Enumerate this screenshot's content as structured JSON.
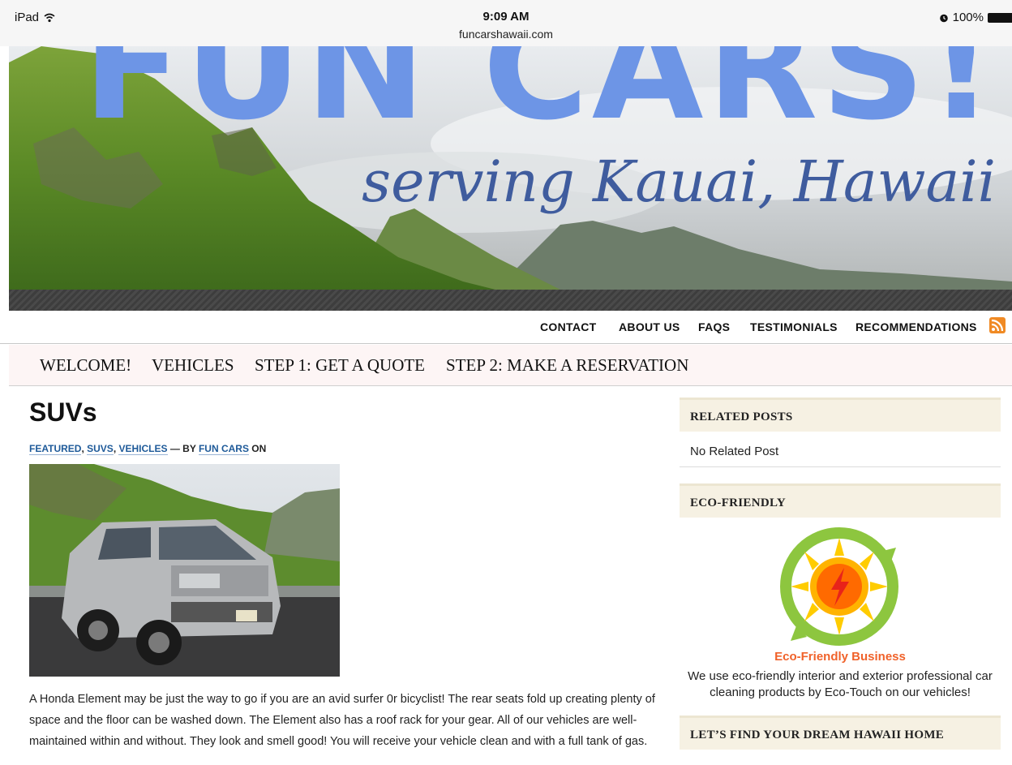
{
  "status": {
    "device": "iPad",
    "time": "9:09 AM",
    "url": "funcarshawaii.com",
    "battery": "100%"
  },
  "hero": {
    "title": "FUN CARS!",
    "subtitle": "serving Kauai, Hawaii"
  },
  "top_nav": [
    "CONTACT",
    "ABOUT US",
    "FAQS",
    "TESTIMONIALS",
    "RECOMMENDATIONS"
  ],
  "main_nav": [
    "WELCOME!",
    "VEHICLES",
    "STEP 1: GET A QUOTE",
    "STEP 2: MAKE A RESERVATION"
  ],
  "post": {
    "title": "SUVs",
    "categories": [
      "FEATURED",
      "SUVS",
      "VEHICLES"
    ],
    "by_text": " — BY ",
    "author": "FUN CARS",
    "on_text": " ON",
    "body": "A Honda Element may be just the way to go if you are an avid surfer 0r bicyclist! The rear seats fold up creating plenty of space and the floor can be washed down. The Element also has a roof rack for your gear. All of our vehicles are well-maintained within and without. They look and smell good! You will receive your vehicle clean and with a full tank of gas."
  },
  "sidebar": {
    "related_title": "RELATED POSTS",
    "related_empty": "No Related Post",
    "eco_title": "ECO-FRIENDLY",
    "eco_caption": "Eco-Friendly Business",
    "eco_text": "We use eco-friendly interior and exterior professional car cleaning products by Eco-Touch on our vehicles!",
    "home_title": "LET’S FIND YOUR DREAM HAWAII HOME"
  },
  "colors": {
    "link": "#1e5a99",
    "hero_title": "#6d95e6",
    "hero_subtitle": "#3f5c9e",
    "widget_bg": "#f6f1e3",
    "rss": "#f08a24",
    "eco_caption": "#f0622a"
  },
  "icons": [
    "wifi-icon",
    "alarm-icon",
    "battery-icon",
    "rss-icon"
  ]
}
